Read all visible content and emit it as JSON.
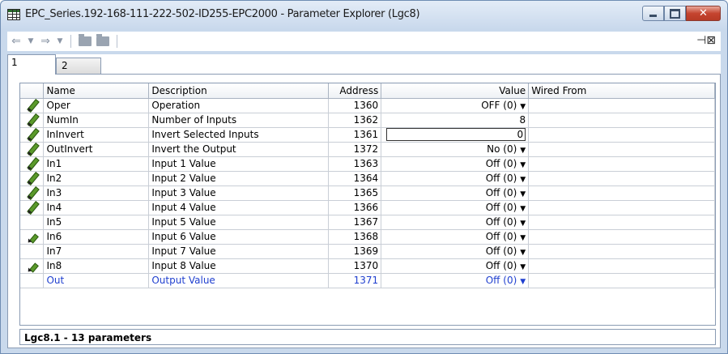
{
  "window": {
    "title": "EPC_Series.192-168-111-222-502-ID255-EPC2000 - Parameter Explorer (Lgc8)",
    "controls": {
      "minimize": "minimize",
      "maximize": "maximize",
      "close": "✕"
    }
  },
  "toolbar": {
    "icons": [
      "back-arrow",
      "dropdown",
      "forward-arrow",
      "dropdown",
      "folder",
      "folder",
      "pin"
    ]
  },
  "tabs": [
    {
      "label": "1",
      "active": true
    },
    {
      "label": "2",
      "active": false
    }
  ],
  "grid": {
    "headers": {
      "name": "Name",
      "description": "Description",
      "address": "Address",
      "value": "Value",
      "wired_from": "Wired From"
    },
    "rows": [
      {
        "name": "Oper",
        "description": "Operation",
        "address": "1360",
        "value": "OFF (0)",
        "dropdown": true,
        "editable": true
      },
      {
        "name": "NumIn",
        "description": "Number of Inputs",
        "address": "1362",
        "value": "8",
        "dropdown": false,
        "editable": true
      },
      {
        "name": "InInvert",
        "description": "Invert Selected Inputs",
        "address": "1361",
        "value": "0",
        "dropdown": false,
        "editable": true,
        "editing": true
      },
      {
        "name": "OutInvert",
        "description": "Invert the Output",
        "address": "1372",
        "value": "No (0)",
        "dropdown": true,
        "editable": true
      },
      {
        "name": "In1",
        "description": "Input 1 Value",
        "address": "1363",
        "value": "Off (0)",
        "dropdown": true,
        "editable": true
      },
      {
        "name": "In2",
        "description": "Input 2 Value",
        "address": "1364",
        "value": "Off (0)",
        "dropdown": true,
        "editable": true
      },
      {
        "name": "In3",
        "description": "Input 3 Value",
        "address": "1365",
        "value": "Off (0)",
        "dropdown": true,
        "editable": true
      },
      {
        "name": "In4",
        "description": "Input 4 Value",
        "address": "1366",
        "value": "Off (0)",
        "dropdown": true,
        "editable": true
      },
      {
        "name": "In5",
        "description": "Input 5 Value",
        "address": "1367",
        "value": "Off (0)",
        "dropdown": true,
        "editable": false
      },
      {
        "name": "In6",
        "description": "Input 6 Value",
        "address": "1368",
        "value": "Off (0)",
        "dropdown": true,
        "editable": "partial"
      },
      {
        "name": "In7",
        "description": "Input 7 Value",
        "address": "1369",
        "value": "Off (0)",
        "dropdown": true,
        "editable": false
      },
      {
        "name": "In8",
        "description": "Input 8 Value",
        "address": "1370",
        "value": "Off (0)",
        "dropdown": true,
        "editable": "partial"
      },
      {
        "name": "Out",
        "description": "Output Value",
        "address": "1371",
        "value": "Off (0)",
        "dropdown": true,
        "editable": false,
        "output": true
      }
    ]
  },
  "status": {
    "text": "Lgc8.1  -  13 parameters"
  },
  "colors": {
    "output_row": "#1f3fcf",
    "pencil": "#5a9a2a",
    "close_button": "#c5442f"
  }
}
